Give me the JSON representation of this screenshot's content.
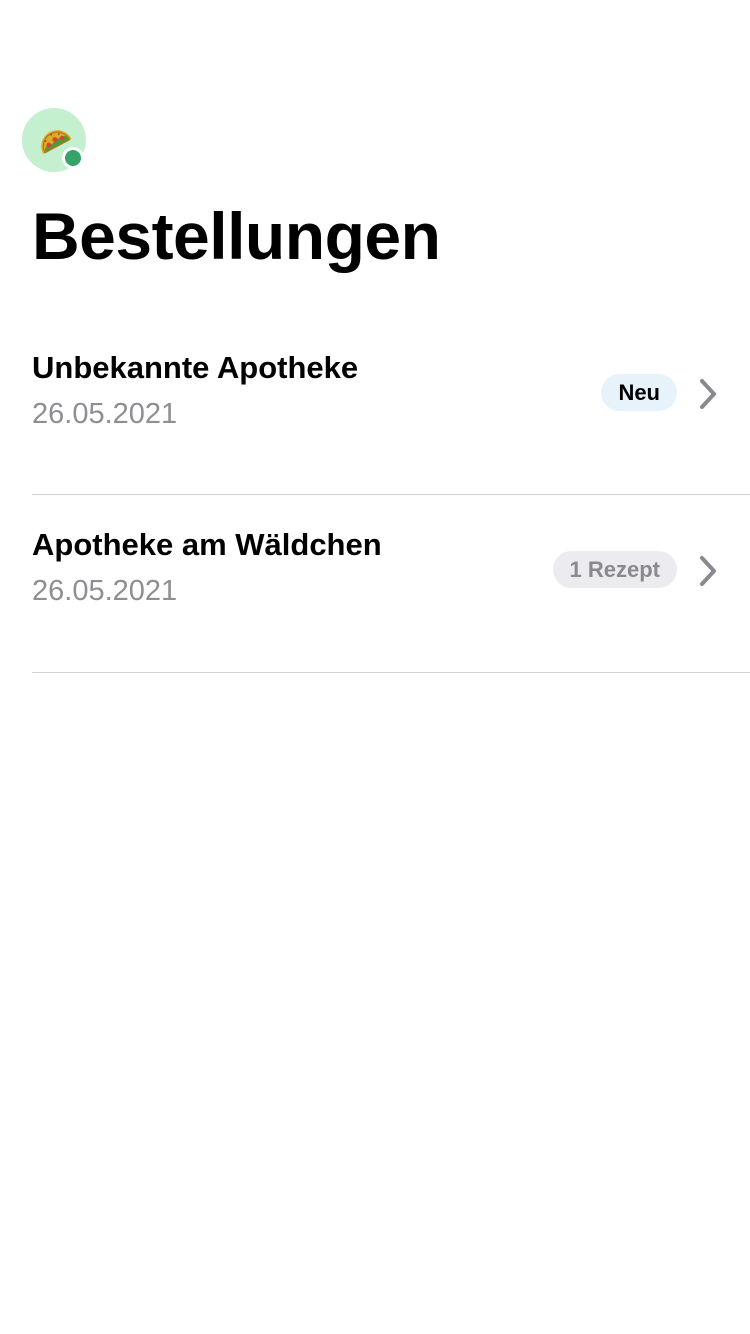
{
  "header": {
    "avatar_icon": "taco-icon",
    "avatar_background": "#c4f0d0",
    "status_indicator_color": "#35a36a",
    "title": "Bestellungen"
  },
  "orders": [
    {
      "name": "Unbekannte Apotheke",
      "date": "26.05.2021",
      "badge": "Neu",
      "badge_style": "new",
      "badge_background": "#e6f3fb",
      "chevron_icon": "chevron-right-icon"
    },
    {
      "name": "Apotheke am Wäldchen",
      "date": "26.05.2021",
      "badge": "1 Rezept",
      "badge_style": "prescription-count",
      "badge_background": "#ebebf0",
      "chevron_icon": "chevron-right-icon"
    }
  ]
}
